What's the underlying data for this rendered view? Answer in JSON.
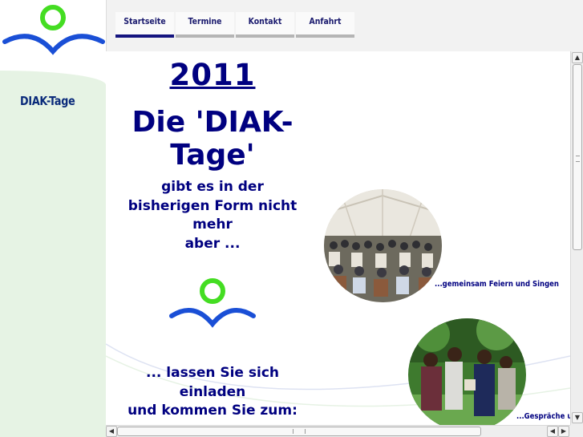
{
  "sidebar": {
    "title": "DIAK-Tage",
    "logo_icon": "diak-logo-icon"
  },
  "nav": {
    "tabs": [
      {
        "label": "Startseite",
        "active": true
      },
      {
        "label": "Termine",
        "active": false
      },
      {
        "label": "Kontakt",
        "active": false
      },
      {
        "label": "Anfahrt",
        "active": false
      }
    ]
  },
  "main": {
    "year": "2011",
    "headline_line1": "Die 'DIAK-",
    "headline_line2": "Tage'",
    "subtext_line1": "gibt es in der",
    "subtext_line2": "bisherigen Form nicht",
    "subtext_line3": "mehr",
    "subtext_line4": "aber ...",
    "invite_line1": "... lassen Sie sich",
    "invite_line2": "einladen",
    "invite_line3": "und kommen Sie zum:",
    "photo1_caption": "...gemeinsam Feiern und Singen",
    "photo2_caption": "...Gespräche u"
  },
  "colors": {
    "text_navy": "#000080",
    "logo_green": "#44dd22",
    "logo_blue": "#1a4fd6",
    "sidebar_green": "#e6f3e4",
    "active_tab": "#14147f"
  },
  "scrollbars": {
    "up_arrow": "▲",
    "down_arrow": "▼",
    "left_arrow": "◀",
    "right_arrow": "▶"
  }
}
